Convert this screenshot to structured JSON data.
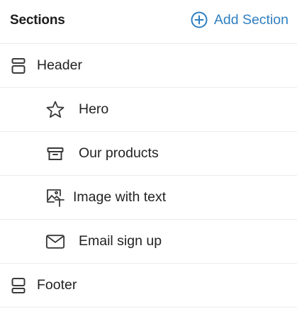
{
  "header": {
    "title": "Sections",
    "add_label": "Add Section",
    "accent_color": "#2f7fc1"
  },
  "sections": [
    {
      "label": "Header",
      "icon": "header-layout-icon",
      "level": "top"
    },
    {
      "label": "Hero",
      "icon": "star-icon",
      "level": "nested"
    },
    {
      "label": "Our products",
      "icon": "archive-box-icon",
      "level": "nested"
    },
    {
      "label": "Image with text",
      "icon": "image-text-icon",
      "level": "nested"
    },
    {
      "label": "Email sign up",
      "icon": "envelope-icon",
      "level": "nested"
    },
    {
      "label": "Footer",
      "icon": "footer-layout-icon",
      "level": "top"
    }
  ]
}
